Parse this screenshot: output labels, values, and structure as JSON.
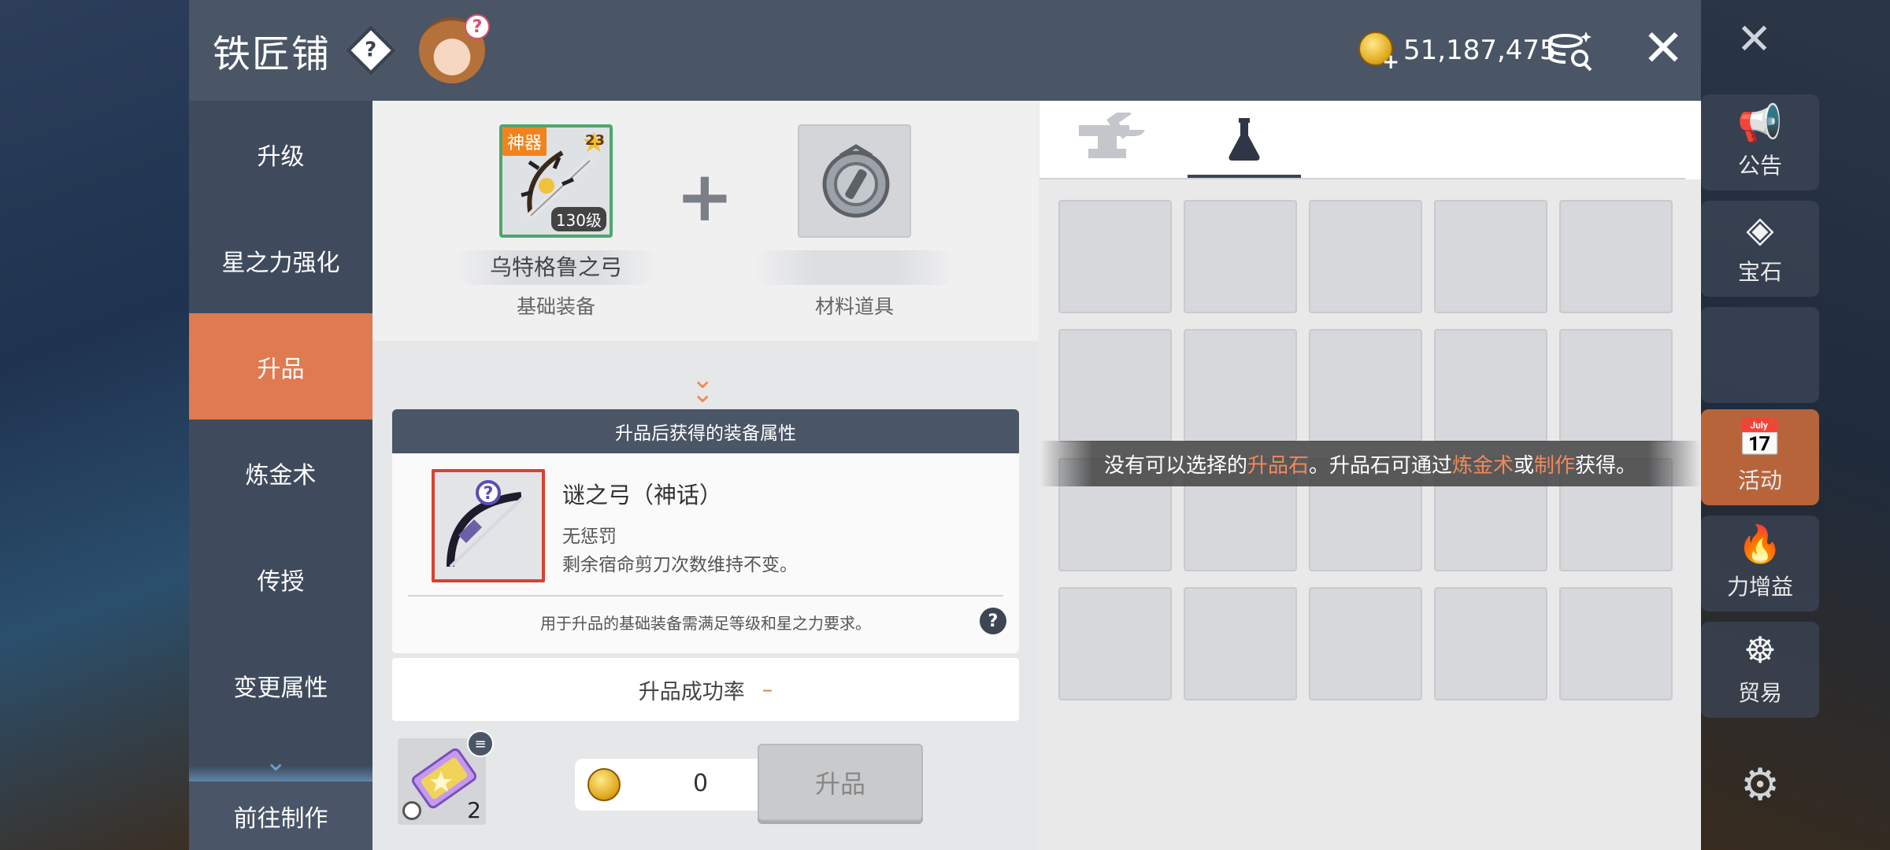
{
  "window": {
    "title": "铁匠铺",
    "help_icon": "help-diamond-icon",
    "mascot_icon": "mascot-help-icon",
    "meso_amount": "51,187,475",
    "close_label": "✕"
  },
  "background": {
    "right_buttons": [
      {
        "label": "公告",
        "icon": "megaphone-icon"
      },
      {
        "label": "宝石",
        "icon": "gem-icon"
      },
      {
        "label": "",
        "icon": ""
      },
      {
        "label": "活动",
        "icon": "calendar-check-icon"
      },
      {
        "label": "力增益",
        "icon": "flame-icon"
      },
      {
        "label": "贸易",
        "icon": "ship-wheel-icon"
      }
    ]
  },
  "nav": {
    "items": [
      {
        "label": "升级",
        "active": false
      },
      {
        "label": "星之力强化",
        "active": false
      },
      {
        "label": "升品",
        "active": true
      },
      {
        "label": "炼金术",
        "active": false
      },
      {
        "label": "传授",
        "active": false
      },
      {
        "label": "变更属性",
        "active": false
      }
    ],
    "bottom_button": "前往制作"
  },
  "equip_slot": {
    "tag": "神器",
    "star": "23",
    "level": "130级",
    "name": "乌特格鲁之弓",
    "label": "基础装备"
  },
  "material_slot": {
    "name": "",
    "label": "材料道具"
  },
  "result": {
    "header": "升品后获得的装备属性",
    "name": "谜之弓（神话）",
    "line1": "无惩罚",
    "line2": "剩余宿命剪刀次数维持不变。",
    "note": "用于升品的基础装备需满足等级和星之力要求。"
  },
  "success_rate": {
    "label": "升品成功率",
    "value": "–"
  },
  "ticket": {
    "count": "2"
  },
  "cost": {
    "value": "0"
  },
  "upgrade_button": "升品",
  "right_panel": {
    "tabs": [
      {
        "icon": "anvil-icon",
        "active": false
      },
      {
        "icon": "flask-icon",
        "active": true
      }
    ],
    "empty_message": {
      "part1": "没有可以选择的",
      "hl1": "升品石",
      "part2": "。升品石可通过",
      "hl2": "炼金术",
      "part3": "或",
      "hl3": "制作",
      "part4": "获得。"
    },
    "grid_rows": 4,
    "grid_cols": 5
  },
  "colors": {
    "accent_orange": "#e07a50",
    "header_dark": "#4a5566",
    "nav_bg": "#3f4b5d",
    "highlight_text": "#f08a5a"
  }
}
